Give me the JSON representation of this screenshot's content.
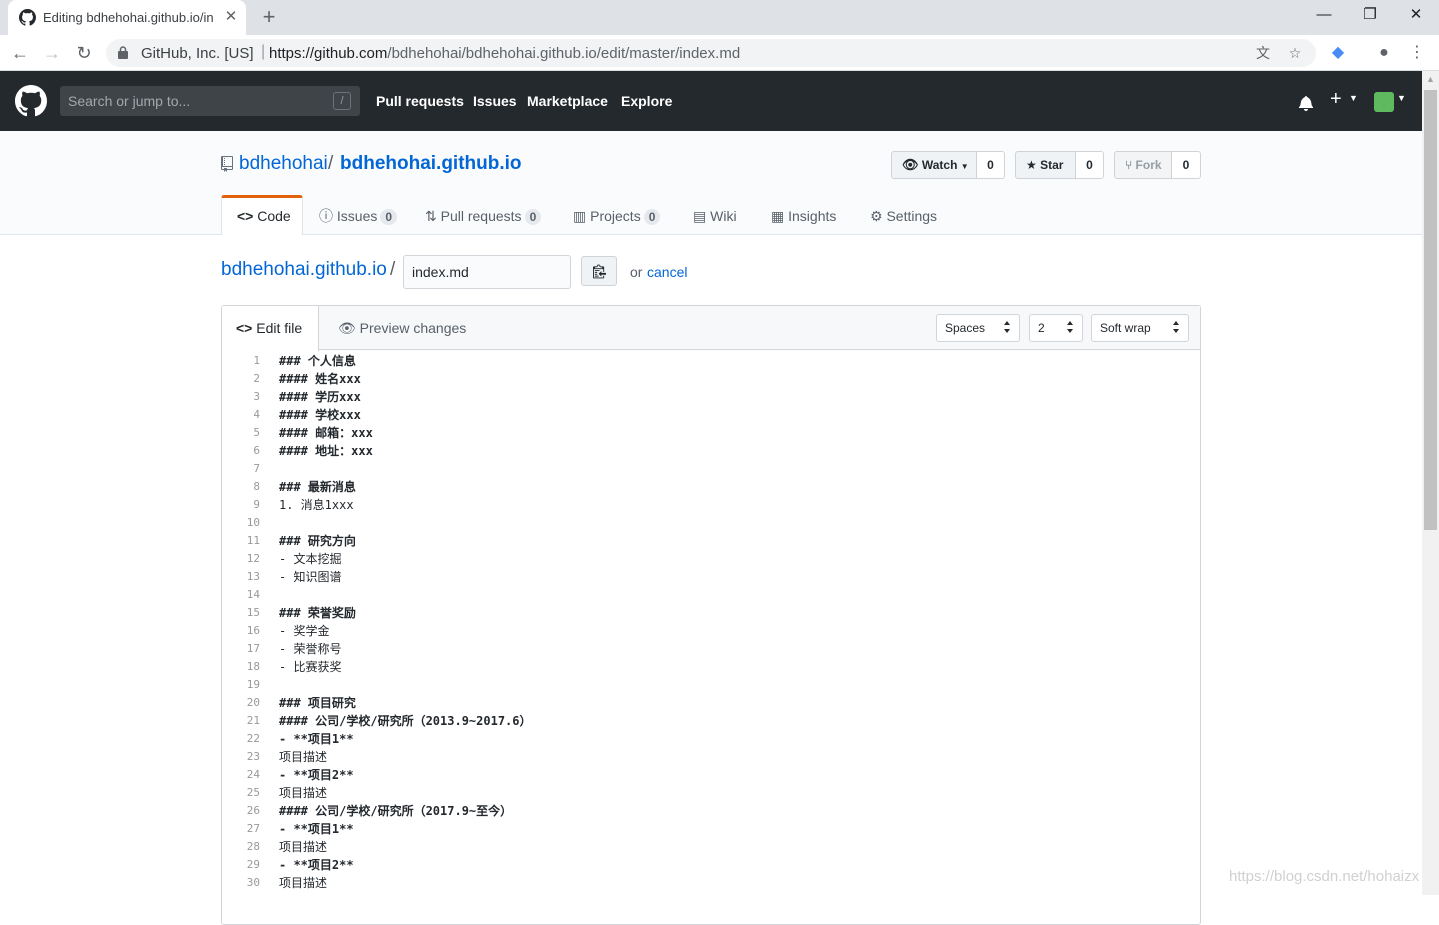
{
  "browser": {
    "tab_title": "Editing bdhehohai.github.io/in",
    "url_org": "GitHub, Inc. [US]",
    "url_host": "https://github.com",
    "url_path": "/bdhehohai/bdhehohai.github.io/edit/master/index.md"
  },
  "header": {
    "search_placeholder": "Search or jump to...",
    "search_key": "/",
    "nav": [
      "Pull requests",
      "Issues",
      "Marketplace",
      "Explore"
    ]
  },
  "repo": {
    "owner": "bdhehohai",
    "separator": "/",
    "name": "bdhehohai.github.io",
    "watch_label": "Watch",
    "watch_count": "0",
    "star_label": "Star",
    "star_count": "0",
    "fork_label": "Fork",
    "fork_count": "0"
  },
  "reponav": {
    "code": "Code",
    "issues": "Issues",
    "issues_count": "0",
    "pulls": "Pull requests",
    "pulls_count": "0",
    "projects": "Projects",
    "projects_count": "0",
    "wiki": "Wiki",
    "insights": "Insights",
    "settings": "Settings"
  },
  "editor": {
    "breadcrumb_repo": "bdhehohai.github.io",
    "breadcrumb_sep": "/",
    "filename": "index.md",
    "or_text": "or",
    "cancel_label": "cancel",
    "edit_tab": "Edit file",
    "preview_tab": "Preview changes",
    "indent_mode": "Spaces",
    "indent_size": "2",
    "wrap_mode": "Soft wrap",
    "lines": [
      "### 个人信息",
      "#### 姓名xxx",
      "#### 学历xxx",
      "#### 学校xxx",
      "#### 邮箱：xxx",
      "#### 地址：xxx",
      "",
      "### 最新消息",
      "1. 消息1xxx",
      "",
      "### 研究方向",
      "- 文本挖掘",
      "- 知识图谱",
      "",
      "### 荣誉奖励",
      "- 奖学金",
      "- 荣誉称号",
      "- 比赛获奖",
      "",
      "### 项目研究",
      "#### 公司/学校/研究所（2013.9~2017.6）",
      "- **项目1**",
      "项目描述",
      "- **项目2**",
      "项目描述",
      "#### 公司/学校/研究所（2017.9~至今）",
      "- **项目1**",
      "项目描述",
      "- **项目2**",
      "项目描述"
    ]
  },
  "watermark": "https://blog.csdn.net/hohaizx",
  "colors": {
    "header_bg": "#24292e",
    "link": "#0366d6",
    "tab_accent": "#e36209"
  }
}
